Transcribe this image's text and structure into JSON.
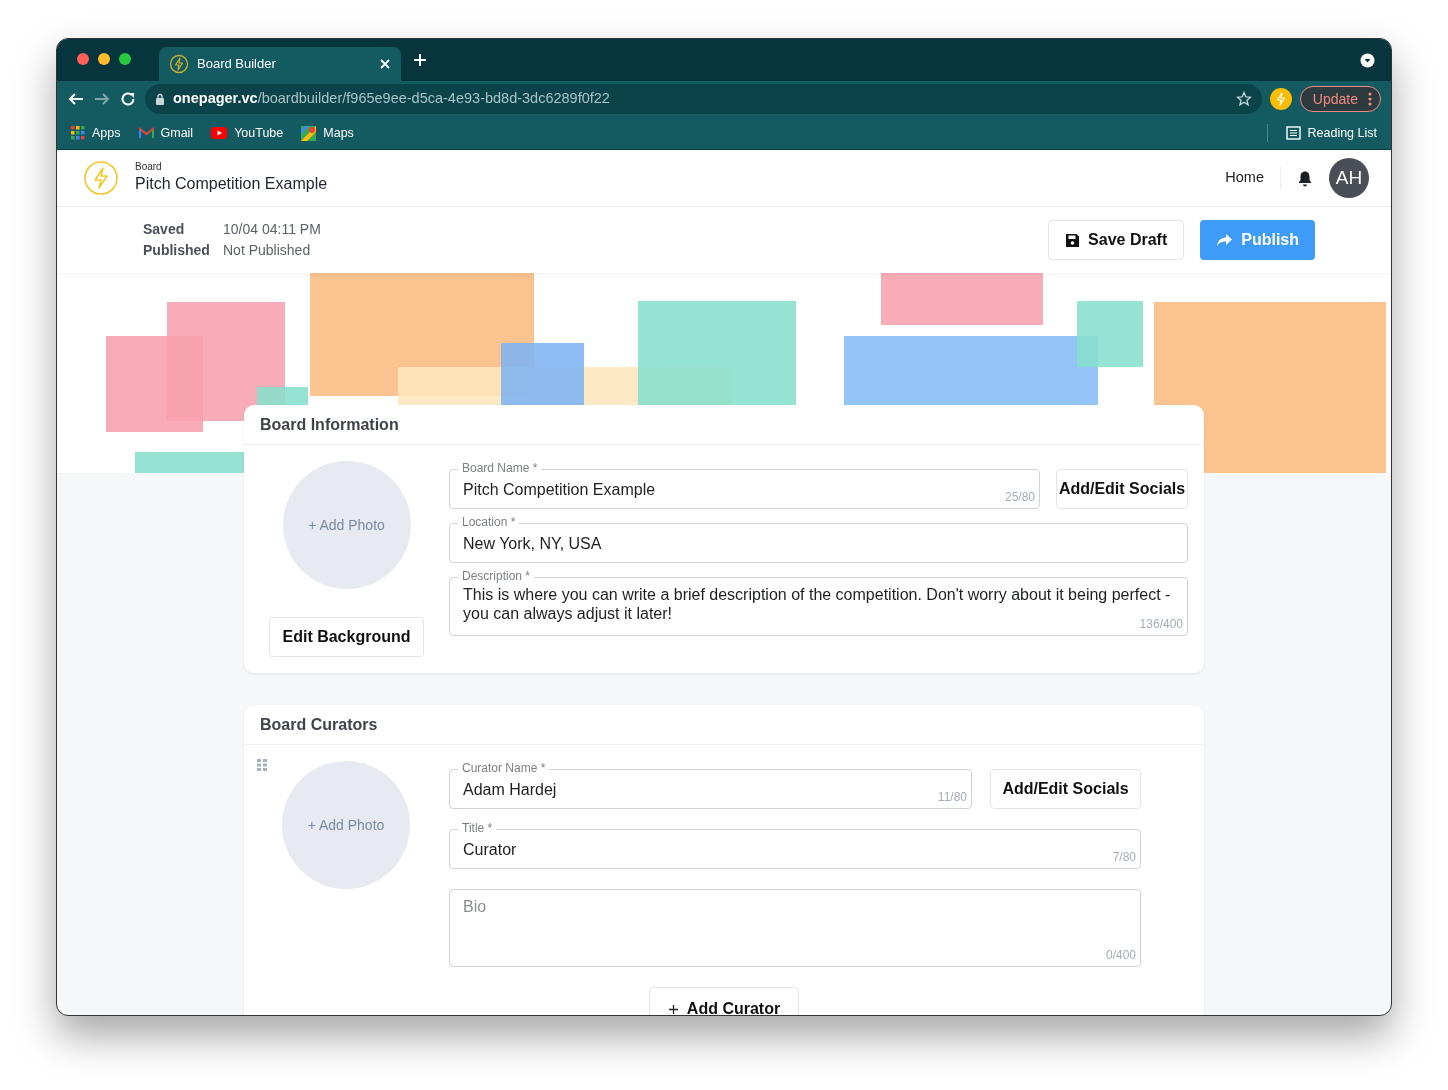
{
  "browser": {
    "tab_title": "Board Builder",
    "url_domain": "onepager.vc",
    "url_path": "/boardbuilder/f965e9ee-d5ca-4e93-bd8d-3dc6289f0f22",
    "update_button": "Update",
    "bookmarks": [
      {
        "label": "Apps",
        "kind": "apps"
      },
      {
        "label": "Gmail",
        "kind": "gmail"
      },
      {
        "label": "YouTube",
        "kind": "youtube"
      },
      {
        "label": "Maps",
        "kind": "maps"
      }
    ],
    "reading_list": "Reading List"
  },
  "header": {
    "breadcrumb": "Board",
    "title": "Pitch Competition Example",
    "nav_link": "Home",
    "avatar": "AH"
  },
  "status": [
    {
      "label": "Saved",
      "value": "10/04 04:11 PM"
    },
    {
      "label": "Published",
      "value": "Not Published"
    }
  ],
  "actions": {
    "save_draft": "Save Draft",
    "publish": "Publish"
  },
  "board_information": {
    "title": "Board Information",
    "add_photo": "+ Add Photo",
    "edit_background": "Edit Background",
    "socials_button": "Add/Edit Socials",
    "fields": [
      {
        "kind": "input",
        "label": "Board Name *",
        "value": "Pitch Competition Example",
        "counter": "25/80"
      },
      {
        "kind": "input",
        "label": "Location *",
        "value": "New York, NY, USA"
      },
      {
        "kind": "textarea",
        "label": "Description *",
        "value": "This is where you can write a brief description of the competition. Don't worry about it being perfect - you can always adjust it later!",
        "counter": "136/400"
      }
    ]
  },
  "board_curators": {
    "title": "Board Curators",
    "add_curator": "Add Curator",
    "curators": [
      {
        "add_photo": "+ Add Photo",
        "socials_button": "Add/Edit Socials",
        "fields": [
          {
            "kind": "input",
            "label": "Curator Name *",
            "value": "Adam Hardej",
            "counter": "11/80"
          },
          {
            "kind": "input",
            "label": "Title *",
            "value": "Curator",
            "counter": "7/80"
          },
          {
            "kind": "textarea",
            "placeholder": "Bio",
            "counter": "0/400"
          }
        ]
      }
    ]
  }
}
